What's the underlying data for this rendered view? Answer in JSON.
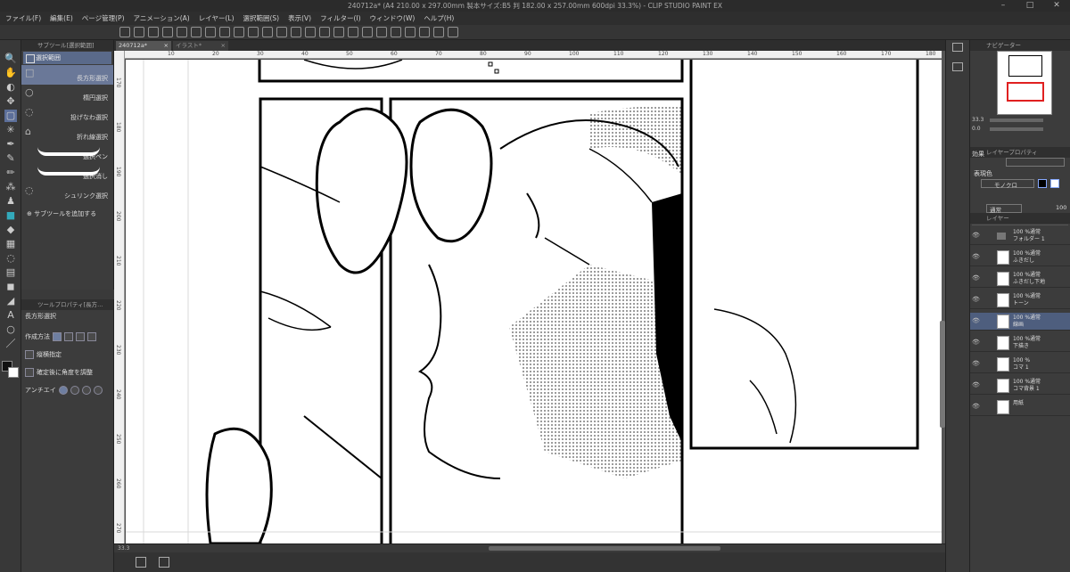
{
  "window": {
    "title": "240712a* (A4 210.00 x 297.00mm 製本サイズ:B5 判 182.00 x 257.00mm 600dpi 33.3%) - CLIP STUDIO PAINT EX"
  },
  "menu": [
    "ファイル(F)",
    "編集(E)",
    "ページ管理(P)",
    "アニメーション(A)",
    "レイヤー(L)",
    "選択範囲(S)",
    "表示(V)",
    "フィルター(I)",
    "ウィンドウ(W)",
    "ヘルプ(H)"
  ],
  "tabs": [
    {
      "label": "240712a*",
      "close": "×"
    },
    {
      "label": "イラスト*",
      "close": "×"
    }
  ],
  "subtool_panel": {
    "header": "サブツール[選択範囲]",
    "group": "選択範囲",
    "items": [
      {
        "label": "長方形選択",
        "icon": "rectangle-icon",
        "active": true
      },
      {
        "label": "楕円選択",
        "icon": "ellipse-icon"
      },
      {
        "label": "投げなわ選択",
        "icon": "lasso-icon"
      },
      {
        "label": "折れ線選択",
        "icon": "polyline-icon"
      },
      {
        "label": "選択ペン",
        "icon": "pen-icon"
      },
      {
        "label": "選択消し",
        "icon": "eraser-icon"
      },
      {
        "label": "シュリンク選択",
        "icon": "shrink-icon"
      }
    ],
    "add_label": "サブツールを追加する"
  },
  "tool_property": {
    "header": "ツールプロパティ[長方...",
    "title": "長方形選択",
    "mode_label": "作成方法",
    "ratio_label": "縦横指定",
    "adjust_label": "確定後に角度を調整",
    "antialias_label": "アンチエイ"
  },
  "ruler": {
    "top": [
      "10",
      "20",
      "30",
      "40",
      "50",
      "60",
      "70",
      "80",
      "90",
      "100",
      "110",
      "120",
      "130",
      "140",
      "150",
      "160",
      "170",
      "180"
    ],
    "left": [
      "170",
      "180",
      "190",
      "200",
      "210",
      "220",
      "230",
      "240",
      "250",
      "260",
      "270"
    ]
  },
  "status": {
    "zoom": "33.3"
  },
  "navigator": {
    "title": "ナビゲーター",
    "zoom": "33.3",
    "angle": "0.0"
  },
  "layer_property": {
    "title": "レイヤープロパティ",
    "effect": "効果",
    "expression_color": "表現色",
    "mode": "モノクロ"
  },
  "layers_panel": {
    "title": "レイヤー",
    "blend": "通常",
    "opacity": "100",
    "layers": [
      {
        "mode": "100 %通常",
        "name": "フォルダー 1",
        "folder": true
      },
      {
        "mode": "100 %通常",
        "name": "ふきだし"
      },
      {
        "mode": "100 %通常",
        "name": "ふきだし下地"
      },
      {
        "mode": "100 %通常",
        "name": "トーン"
      },
      {
        "mode": "100 %通常",
        "name": "線画",
        "selected": true
      },
      {
        "mode": "100 %通常",
        "name": "下描き"
      },
      {
        "mode": "100 %",
        "name": "コマ 1"
      },
      {
        "mode": "100 %通常",
        "name": "コマ背景 1"
      },
      {
        "mode": "",
        "name": "用紙"
      }
    ]
  }
}
